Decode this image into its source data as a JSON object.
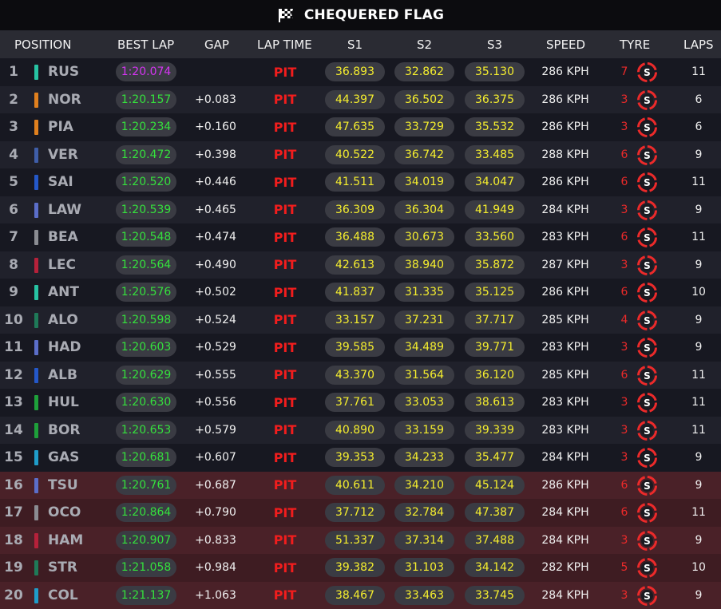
{
  "title": "CHEQUERED FLAG",
  "flag_icon": "chequered-flag-icon",
  "tyre_icon": "soft-tyre-icon",
  "colors": {
    "fastest_lap": "#d535f2",
    "best_lap": "#35e03d",
    "sector": "#f5ee2e",
    "pit": "#f21d1d",
    "tyre": "#ec2a2a",
    "eliminated_row": "#3e1c22"
  },
  "headers": {
    "position": "POSITION",
    "best_lap": "BEST LAP",
    "gap": "GAP",
    "lap_time": "LAP TIME",
    "s1": "S1",
    "s2": "S2",
    "s3": "S3",
    "speed": "SPEED",
    "tyre": "TYRE",
    "laps": "LAPS"
  },
  "rows": [
    {
      "pos": "1",
      "team_color": "#27c3a3",
      "driver": "RUS",
      "best_lap": "1:20.074",
      "gap": "",
      "lap_time": "PIT",
      "s1": "36.893",
      "s2": "32.862",
      "s3": "35.130",
      "speed": "286 KPH",
      "tyre_age": "7",
      "tyre_compound": "S",
      "laps": "11",
      "fastest": true,
      "eliminated": false
    },
    {
      "pos": "2",
      "team_color": "#e0801e",
      "driver": "NOR",
      "best_lap": "1:20.157",
      "gap": "+0.083",
      "lap_time": "PIT",
      "s1": "44.397",
      "s2": "36.502",
      "s3": "36.375",
      "speed": "286 KPH",
      "tyre_age": "3",
      "tyre_compound": "S",
      "laps": "6",
      "fastest": false,
      "eliminated": false
    },
    {
      "pos": "3",
      "team_color": "#e0801e",
      "driver": "PIA",
      "best_lap": "1:20.234",
      "gap": "+0.160",
      "lap_time": "PIT",
      "s1": "47.635",
      "s2": "33.729",
      "s3": "35.532",
      "speed": "286 KPH",
      "tyre_age": "3",
      "tyre_compound": "S",
      "laps": "6",
      "fastest": false,
      "eliminated": false
    },
    {
      "pos": "4",
      "team_color": "#3f5ea8",
      "driver": "VER",
      "best_lap": "1:20.472",
      "gap": "+0.398",
      "lap_time": "PIT",
      "s1": "40.522",
      "s2": "36.742",
      "s3": "33.485",
      "speed": "288 KPH",
      "tyre_age": "6",
      "tyre_compound": "S",
      "laps": "9",
      "fastest": false,
      "eliminated": false
    },
    {
      "pos": "5",
      "team_color": "#2458c9",
      "driver": "SAI",
      "best_lap": "1:20.520",
      "gap": "+0.446",
      "lap_time": "PIT",
      "s1": "41.511",
      "s2": "34.019",
      "s3": "34.047",
      "speed": "286 KPH",
      "tyre_age": "6",
      "tyre_compound": "S",
      "laps": "11",
      "fastest": false,
      "eliminated": false
    },
    {
      "pos": "6",
      "team_color": "#5b6ec9",
      "driver": "LAW",
      "best_lap": "1:20.539",
      "gap": "+0.465",
      "lap_time": "PIT",
      "s1": "36.309",
      "s2": "36.304",
      "s3": "41.949",
      "speed": "284 KPH",
      "tyre_age": "3",
      "tyre_compound": "S",
      "laps": "9",
      "fastest": false,
      "eliminated": false
    },
    {
      "pos": "7",
      "team_color": "#8a8c92",
      "driver": "BEA",
      "best_lap": "1:20.548",
      "gap": "+0.474",
      "lap_time": "PIT",
      "s1": "36.488",
      "s2": "30.673",
      "s3": "33.560",
      "speed": "283 KPH",
      "tyre_age": "6",
      "tyre_compound": "S",
      "laps": "11",
      "fastest": false,
      "eliminated": false
    },
    {
      "pos": "8",
      "team_color": "#b5213a",
      "driver": "LEC",
      "best_lap": "1:20.564",
      "gap": "+0.490",
      "lap_time": "PIT",
      "s1": "42.613",
      "s2": "38.940",
      "s3": "35.872",
      "speed": "287 KPH",
      "tyre_age": "3",
      "tyre_compound": "S",
      "laps": "9",
      "fastest": false,
      "eliminated": false
    },
    {
      "pos": "9",
      "team_color": "#27c3a3",
      "driver": "ANT",
      "best_lap": "1:20.576",
      "gap": "+0.502",
      "lap_time": "PIT",
      "s1": "41.837",
      "s2": "31.335",
      "s3": "35.125",
      "speed": "286 KPH",
      "tyre_age": "6",
      "tyre_compound": "S",
      "laps": "10",
      "fastest": false,
      "eliminated": false
    },
    {
      "pos": "10",
      "team_color": "#1f7a58",
      "driver": "ALO",
      "best_lap": "1:20.598",
      "gap": "+0.524",
      "lap_time": "PIT",
      "s1": "33.157",
      "s2": "37.231",
      "s3": "37.717",
      "speed": "285 KPH",
      "tyre_age": "4",
      "tyre_compound": "S",
      "laps": "9",
      "fastest": false,
      "eliminated": false
    },
    {
      "pos": "11",
      "team_color": "#5b6ec9",
      "driver": "HAD",
      "best_lap": "1:20.603",
      "gap": "+0.529",
      "lap_time": "PIT",
      "s1": "39.585",
      "s2": "34.489",
      "s3": "39.771",
      "speed": "283 KPH",
      "tyre_age": "3",
      "tyre_compound": "S",
      "laps": "9",
      "fastest": false,
      "eliminated": false
    },
    {
      "pos": "12",
      "team_color": "#2458c9",
      "driver": "ALB",
      "best_lap": "1:20.629",
      "gap": "+0.555",
      "lap_time": "PIT",
      "s1": "43.370",
      "s2": "31.564",
      "s3": "36.120",
      "speed": "285 KPH",
      "tyre_age": "6",
      "tyre_compound": "S",
      "laps": "11",
      "fastest": false,
      "eliminated": false
    },
    {
      "pos": "13",
      "team_color": "#1ea03a",
      "driver": "HUL",
      "best_lap": "1:20.630",
      "gap": "+0.556",
      "lap_time": "PIT",
      "s1": "37.761",
      "s2": "33.053",
      "s3": "38.613",
      "speed": "283 KPH",
      "tyre_age": "3",
      "tyre_compound": "S",
      "laps": "11",
      "fastest": false,
      "eliminated": false
    },
    {
      "pos": "14",
      "team_color": "#1ea03a",
      "driver": "BOR",
      "best_lap": "1:20.653",
      "gap": "+0.579",
      "lap_time": "PIT",
      "s1": "40.890",
      "s2": "33.159",
      "s3": "39.339",
      "speed": "283 KPH",
      "tyre_age": "3",
      "tyre_compound": "S",
      "laps": "11",
      "fastest": false,
      "eliminated": false
    },
    {
      "pos": "15",
      "team_color": "#1f9cc9",
      "driver": "GAS",
      "best_lap": "1:20.681",
      "gap": "+0.607",
      "lap_time": "PIT",
      "s1": "39.353",
      "s2": "34.233",
      "s3": "35.477",
      "speed": "284 KPH",
      "tyre_age": "3",
      "tyre_compound": "S",
      "laps": "9",
      "fastest": false,
      "eliminated": false
    },
    {
      "pos": "16",
      "team_color": "#5b6ec9",
      "driver": "TSU",
      "best_lap": "1:20.761",
      "gap": "+0.687",
      "lap_time": "PIT",
      "s1": "40.611",
      "s2": "34.210",
      "s3": "45.124",
      "speed": "286 KPH",
      "tyre_age": "6",
      "tyre_compound": "S",
      "laps": "9",
      "fastest": false,
      "eliminated": true
    },
    {
      "pos": "17",
      "team_color": "#8a8c92",
      "driver": "OCO",
      "best_lap": "1:20.864",
      "gap": "+0.790",
      "lap_time": "PIT",
      "s1": "37.712",
      "s2": "32.784",
      "s3": "47.387",
      "speed": "284 KPH",
      "tyre_age": "6",
      "tyre_compound": "S",
      "laps": "11",
      "fastest": false,
      "eliminated": true
    },
    {
      "pos": "18",
      "team_color": "#b5213a",
      "driver": "HAM",
      "best_lap": "1:20.907",
      "gap": "+0.833",
      "lap_time": "PIT",
      "s1": "51.337",
      "s2": "37.314",
      "s3": "37.488",
      "speed": "284 KPH",
      "tyre_age": "3",
      "tyre_compound": "S",
      "laps": "9",
      "fastest": false,
      "eliminated": true
    },
    {
      "pos": "19",
      "team_color": "#1f7a58",
      "driver": "STR",
      "best_lap": "1:21.058",
      "gap": "+0.984",
      "lap_time": "PIT",
      "s1": "39.382",
      "s2": "31.103",
      "s3": "34.142",
      "speed": "282 KPH",
      "tyre_age": "5",
      "tyre_compound": "S",
      "laps": "10",
      "fastest": false,
      "eliminated": true
    },
    {
      "pos": "20",
      "team_color": "#1f9cc9",
      "driver": "COL",
      "best_lap": "1:21.137",
      "gap": "+1.063",
      "lap_time": "PIT",
      "s1": "38.467",
      "s2": "33.463",
      "s3": "33.745",
      "speed": "284 KPH",
      "tyre_age": "3",
      "tyre_compound": "S",
      "laps": "9",
      "fastest": false,
      "eliminated": true
    }
  ]
}
